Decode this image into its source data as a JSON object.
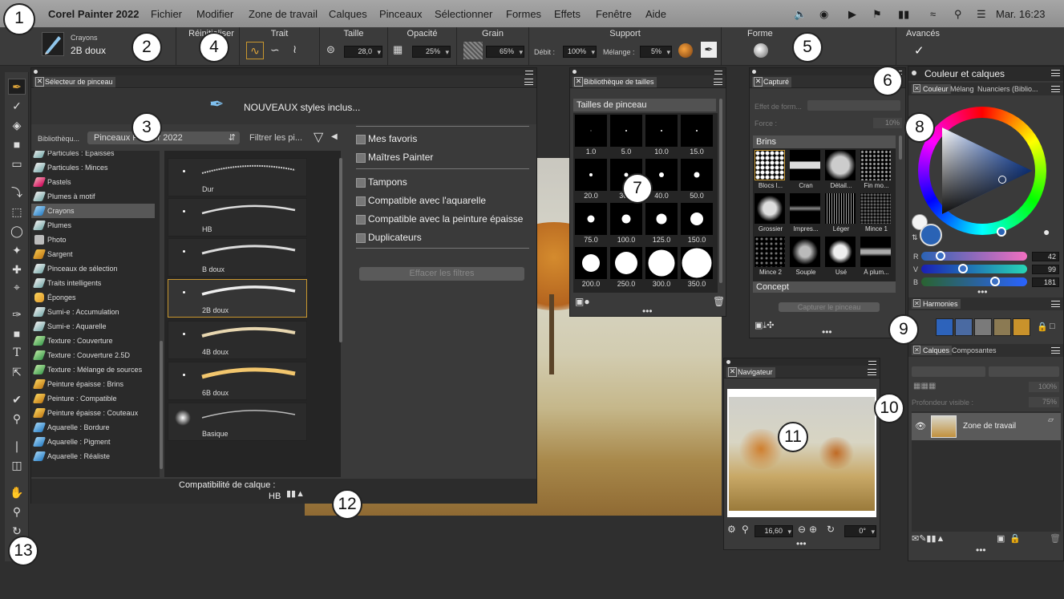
{
  "menubar": {
    "app_name": "Corel Painter 2022",
    "menus": [
      "Fichier",
      "Modifier",
      "Zone de travail",
      "Calques",
      "Pinceaux",
      "Sélectionner",
      "Formes",
      "Effets",
      "Fenêtre",
      "Aide"
    ],
    "clock": "Mar. 16:23"
  },
  "options_bar": {
    "brush_category": "Crayons",
    "brush_variant": "2B doux",
    "reset_label": "Réinitialiser",
    "stroke_label": "Trait",
    "size_label": "Taille",
    "size_value": "28,0",
    "opacity_label": "Opacité",
    "opacity_value": "25%",
    "grain_label": "Grain",
    "grain_value": "65%",
    "support_label": "Support",
    "flow_label": "Débit :",
    "flow_value": "100%",
    "mix_label": "Mélange :",
    "mix_value": "5%",
    "shape_label": "Forme",
    "advanced_label": "Avancés"
  },
  "brush_selector": {
    "tab": "Sélecteur de pinceau",
    "banner": "NOUVEAUX styles inclus...",
    "library_label": "Bibliothèqu...",
    "library_value": "Pinceaux Painter 2022",
    "filter_label": "Filtrer les pi...",
    "categories": [
      {
        "label": "Particules : Épaisses"
      },
      {
        "label": "Particules : Minces"
      },
      {
        "label": "Pastels"
      },
      {
        "label": "Plumes à motif"
      },
      {
        "label": "Crayons"
      },
      {
        "label": "Plumes"
      },
      {
        "label": "Photo"
      },
      {
        "label": "Sargent"
      },
      {
        "label": "Pinceaux de sélection"
      },
      {
        "label": "Traits intelligents"
      },
      {
        "label": "Éponges"
      },
      {
        "label": "Sumi-e : Accumulation"
      },
      {
        "label": "Sumi-e : Aquarelle"
      },
      {
        "label": "Texture : Couverture"
      },
      {
        "label": "Texture : Couverture 2.5D"
      },
      {
        "label": "Texture : Mélange de sources"
      },
      {
        "label": "Peinture épaisse : Brins"
      },
      {
        "label": "Peinture : Compatible"
      },
      {
        "label": "Peinture épaisse : Couteaux"
      },
      {
        "label": "Aquarelle : Bordure"
      },
      {
        "label": "Aquarelle : Pigment"
      },
      {
        "label": "Aquarelle : Réaliste"
      }
    ],
    "variants": [
      {
        "label": "Dur"
      },
      {
        "label": "HB"
      },
      {
        "label": "B doux"
      },
      {
        "label": "2B doux"
      },
      {
        "label": "4B doux"
      },
      {
        "label": "6B doux"
      },
      {
        "label": "Basique"
      }
    ],
    "filters": [
      {
        "label": "Mes favoris"
      },
      {
        "label": "Maîtres Painter"
      },
      {
        "label": "Tampons"
      },
      {
        "label": "Compatible avec l'aquarelle"
      },
      {
        "label": "Compatible avec la peinture épaisse"
      },
      {
        "label": "Duplicateurs"
      }
    ],
    "clear_filters": "Effacer les filtres",
    "layer_compat_label": "Compatibilité de calque :",
    "layer_compat_value": "HB"
  },
  "size_library": {
    "tab": "Bibliothèque de tailles",
    "section": "Tailles de pinceau",
    "sizes": [
      "1.0",
      "5.0",
      "10.0",
      "15.0",
      "20.0",
      "30.0",
      "40.0",
      "50.0",
      "75.0",
      "100.0",
      "125.0",
      "150.0",
      "200.0",
      "250.0",
      "300.0",
      "350.0"
    ]
  },
  "captured": {
    "tab": "Capturé",
    "effect_label": "Effet de form...",
    "force_label": "Force :",
    "force_value": "10%",
    "section_brins": "Brins",
    "dabs": [
      "Blocs l...",
      "Cran",
      "Détail...",
      "Fin mo...",
      "Grossier",
      "Impres...",
      "Léger",
      "Mince 1",
      "Mince 2",
      "Souple",
      "Usé",
      "À plum..."
    ],
    "section_concept": "Concept",
    "capture_button": "Capturer le pinceau"
  },
  "color_panel": {
    "title": "Couleur et calques",
    "tabs": [
      "Couleur",
      "Mélang",
      "Nuanciers (Biblio..."
    ],
    "rgb": [
      {
        "label": "R",
        "value": "42"
      },
      {
        "label": "V",
        "value": "99"
      },
      {
        "label": "B",
        "value": "181"
      }
    ],
    "main_color": "#2a63b5"
  },
  "harmonies": {
    "tab": "Harmonies",
    "swatches": [
      "#2d63bb",
      "#4a6aa2",
      "#7a7a7a",
      "#8b7a53",
      "#c9922b"
    ]
  },
  "layers": {
    "tabs": [
      "Calques",
      "Composantes"
    ],
    "opacity_value": "100%",
    "depth_label": "Profondeur visible :",
    "depth_value": "75%",
    "layer_name": "Zone de travail"
  },
  "navigator": {
    "tab": "Navigateur",
    "zoom_value": "16,60",
    "rotation_value": "0°"
  },
  "callouts": [
    "1",
    "2",
    "3",
    "4",
    "5",
    "6",
    "7",
    "8",
    "9",
    "10",
    "11",
    "12",
    "13"
  ]
}
